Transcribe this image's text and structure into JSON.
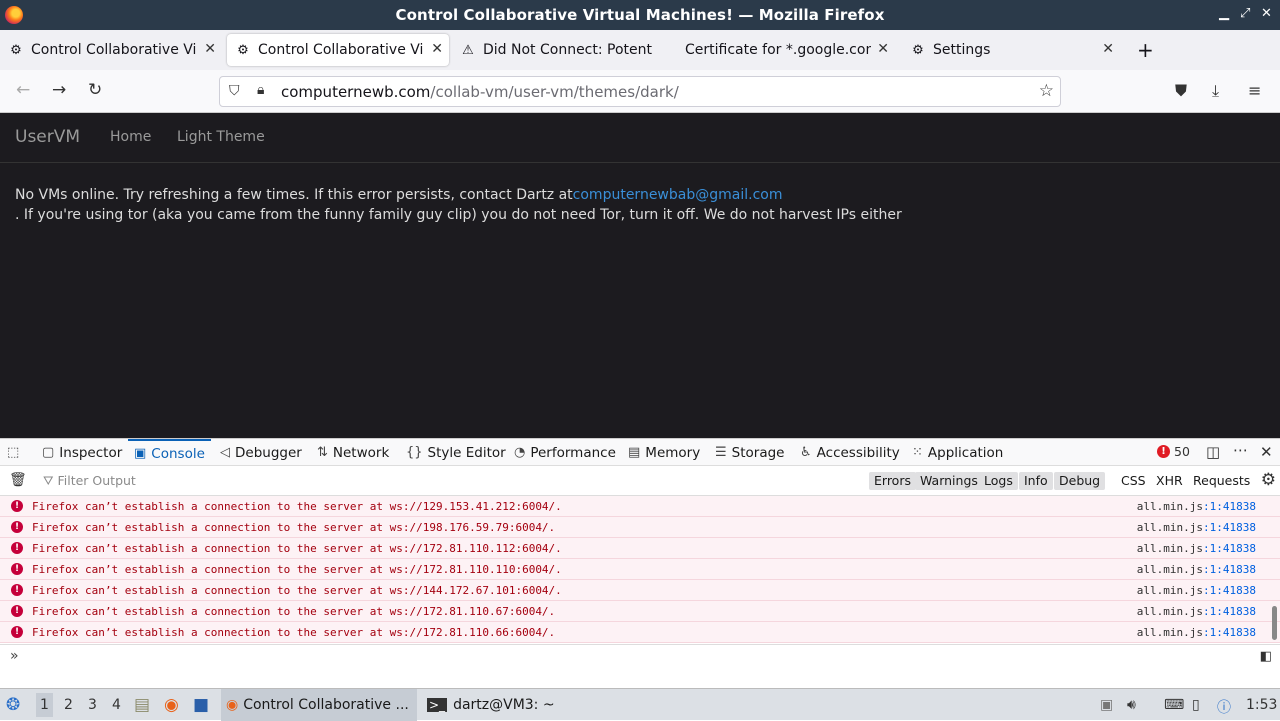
{
  "window": {
    "title": "Control Collaborative Virtual Machines! — Mozilla Firefox"
  },
  "tabs": [
    {
      "label": "Control Collaborative Virtual Machines!",
      "icon": "vm-icon"
    },
    {
      "label": "Control Collaborative Virtual Machines!",
      "icon": "vm-icon",
      "active": true
    },
    {
      "label": "Did Not Connect: Potential Security Issue",
      "icon": "warning-icon"
    },
    {
      "label": "Certificate for *.google.com",
      "icon": "none"
    },
    {
      "label": "Settings",
      "icon": "gear-icon"
    }
  ],
  "url": {
    "host": "computernewb.com",
    "path": "/collab-vm/user-vm/themes/dark/"
  },
  "page": {
    "brand": "UserVM",
    "links": [
      "Home",
      "Light Theme"
    ],
    "message_line1": "No VMs online. Try refreshing a few times. If this error persists, contact Dartz at",
    "email": "computernewbab@gmail.com",
    "message_line2": ". If you're using tor (aka you came from the funny family guy clip) you do not need Tor, turn it off. We do not harvest IPs either"
  },
  "devtools": {
    "tabs": [
      "Inspector",
      "Console",
      "Debugger",
      "Network",
      "Style Editor",
      "Performance",
      "Memory",
      "Storage",
      "Accessibility",
      "Application"
    ],
    "active_tab": "Console",
    "error_count": "50",
    "filter_placeholder": "Filter Output",
    "filters": [
      "Errors",
      "Warnings",
      "Logs",
      "Info",
      "Debug"
    ],
    "extra_filters": [
      "CSS",
      "XHR",
      "Requests"
    ]
  },
  "console": {
    "rows": [
      {
        "text": "Firefox can’t establish a connection to the server at ws://129.153.41.212:6004/.",
        "file": "all.min.js",
        "loc": ":1:41838"
      },
      {
        "text": "Firefox can’t establish a connection to the server at ws://198.176.59.79:6004/.",
        "file": "all.min.js",
        "loc": ":1:41838"
      },
      {
        "text": "Firefox can’t establish a connection to the server at ws://172.81.110.112:6004/.",
        "file": "all.min.js",
        "loc": ":1:41838"
      },
      {
        "text": "Firefox can’t establish a connection to the server at ws://172.81.110.110:6004/.",
        "file": "all.min.js",
        "loc": ":1:41838"
      },
      {
        "text": "Firefox can’t establish a connection to the server at ws://144.172.67.101:6004/.",
        "file": "all.min.js",
        "loc": ":1:41838"
      },
      {
        "text": "Firefox can’t establish a connection to the server at ws://172.81.110.67:6004/.",
        "file": "all.min.js",
        "loc": ":1:41838"
      },
      {
        "text": "Firefox can’t establish a connection to the server at ws://172.81.110.66:6004/.",
        "file": "all.min.js",
        "loc": ":1:41838"
      }
    ]
  },
  "taskbar": {
    "workspaces": [
      "1",
      "2",
      "3",
      "4"
    ],
    "active_workspace": "1",
    "window_firefox": "Control Collaborative ...",
    "window_terminal": "dartz@VM3: ~",
    "clock": "1:53"
  }
}
